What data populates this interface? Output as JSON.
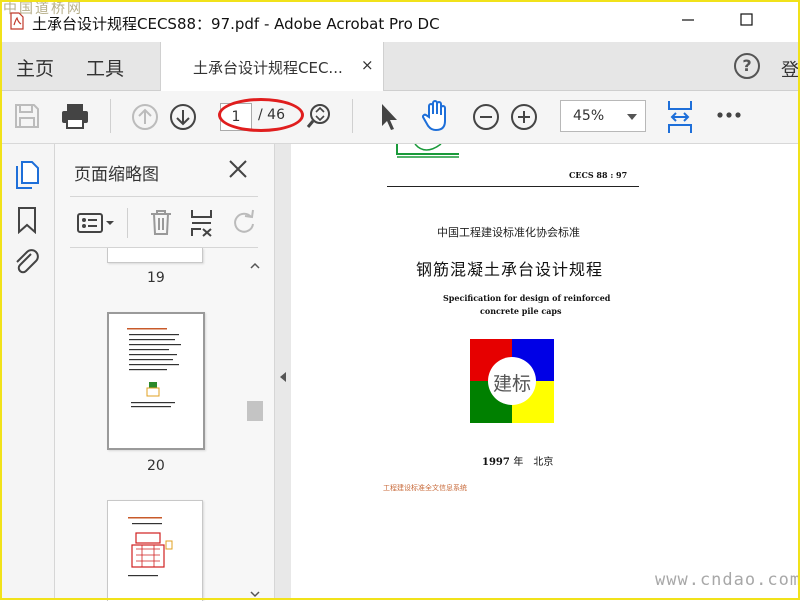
{
  "window": {
    "title": "土承台设计规程CECS88：97.pdf - Adobe Acrobat Pro DC",
    "watermark_top": "中国道桥网"
  },
  "tabs": {
    "home": "主页",
    "tools": "工具",
    "document": "土承台设计规程CEC...",
    "close_glyph": "×",
    "help_glyph": "?",
    "signin": "登"
  },
  "toolbar": {
    "page_current": "1",
    "page_total": "/ 46",
    "zoom": "45%"
  },
  "thumbnail_panel": {
    "title": "页面缩略图",
    "labels": [
      "19",
      "20"
    ]
  },
  "document": {
    "code": "CECS 88 : 97",
    "association": "中国工程建设标准化协会标准",
    "title": "钢筋混凝土承台设计规程",
    "english_line1": "Specification for design of reinforced",
    "english_line2": "concrete pile caps",
    "logo_text": "建标",
    "year": "1997",
    "year_suffix": "年　北京",
    "footer": "工程建设标准全文信息系统"
  },
  "watermark_bottom": "www.cndao.com",
  "colors": {
    "annotation_ellipse": "#e01e1e",
    "hand_tool": "#1e6fd9",
    "fit_icon": "#1e6fd9",
    "logo_red": "#e60000",
    "logo_blue": "#0000e6",
    "logo_green": "#008000",
    "logo_yellow": "#ffff00",
    "screen_border": "#f1e21a"
  }
}
